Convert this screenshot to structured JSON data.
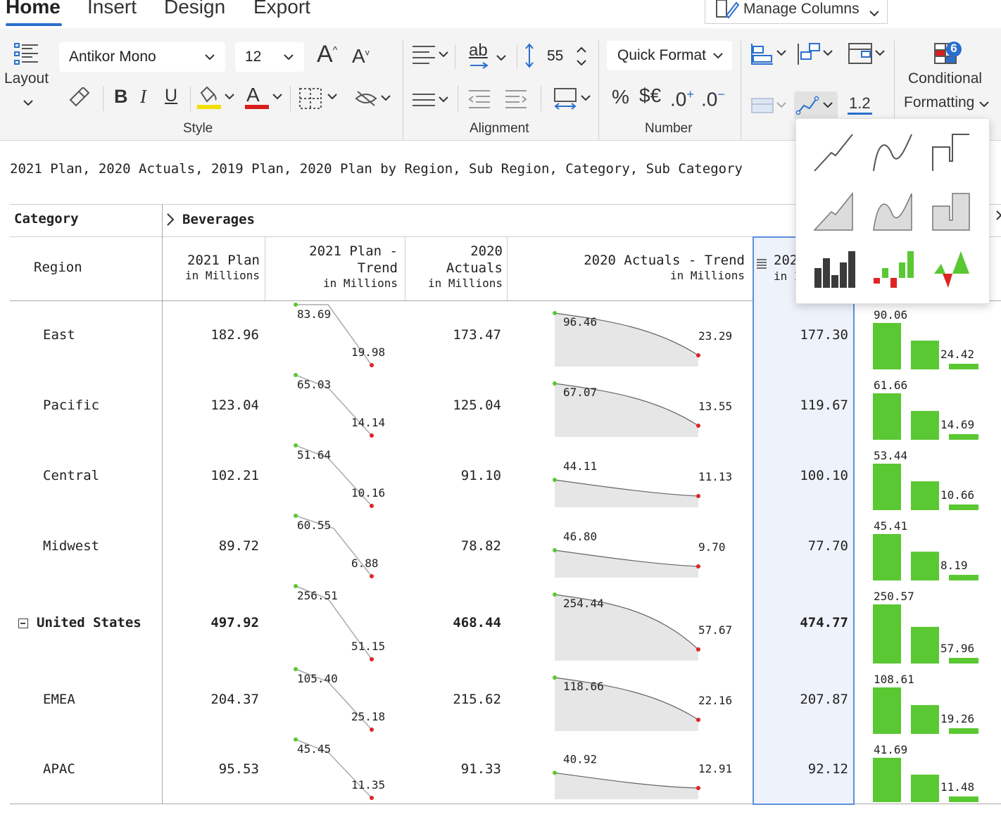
{
  "tabs": [
    {
      "label": "Home",
      "active": true
    },
    {
      "label": "Insert"
    },
    {
      "label": "Design"
    },
    {
      "label": "Export"
    }
  ],
  "manage_columns": "Manage Columns",
  "ribbon": {
    "layout_label": "Layout",
    "font_family": "Antikor Mono",
    "font_size": "12",
    "row_height": "55",
    "quick_format": "Quick Format",
    "percent": "%",
    "currency": "$€",
    "decimal_display": "1.2",
    "conditional_formatting_line1": "Conditional",
    "conditional_formatting_line2": "Formatting",
    "cf_badge": "6",
    "groups": {
      "style": "Style",
      "alignment": "Alignment",
      "number": "Number"
    },
    "style_buttons": {
      "bold": "B",
      "italic": "I",
      "underline": "U",
      "font_color": "A"
    },
    "wrap_text": "ab",
    "grow_font": "A",
    "shrink_font": "A",
    "decimal_inc": ".0",
    "decimal_dec": ".0",
    "colors": {
      "highlight": "#f3e000",
      "font_color": "#d81e1e",
      "accent": "#2a6fcf"
    }
  },
  "caption": "2021 Plan, 2020 Actuals, 2019 Plan, 2020 Plan by Region, Sub Region, Category, Sub Category",
  "table": {
    "category_label": "Category",
    "category_value": "Beverages",
    "region_label": "Region",
    "columns": [
      {
        "title": "2021 Plan",
        "unit": "in Millions"
      },
      {
        "title1": "2021 Plan -",
        "title2": "Trend",
        "unit": "in Millions"
      },
      {
        "title1": "2020",
        "title2": "Actuals",
        "unit": "in Millions"
      },
      {
        "title": "2020 Actuals - Trend",
        "unit": "in Millions"
      },
      {
        "title": "202",
        "unit": "in I"
      }
    ],
    "rows": [
      {
        "region": "East",
        "plan2021": "182.96",
        "trend_start": "83.69",
        "trend_end": "19.98",
        "actuals2020": "173.47",
        "act_start": "96.46",
        "act_end": "23.29",
        "col5": "177.30",
        "bar_top": "90.06",
        "bar_end": "24.42"
      },
      {
        "region": "Pacific",
        "plan2021": "123.04",
        "trend_start": "65.03",
        "trend_end": "14.14",
        "actuals2020": "125.04",
        "act_start": "67.07",
        "act_end": "13.55",
        "col5": "119.67",
        "bar_top": "61.66",
        "bar_end": "14.69"
      },
      {
        "region": "Central",
        "plan2021": "102.21",
        "trend_start": "51.64",
        "trend_end": "10.16",
        "actuals2020": "91.10",
        "act_start": "44.11",
        "act_end": "11.13",
        "col5": "100.10",
        "bar_top": "53.44",
        "bar_end": "10.66"
      },
      {
        "region": "Midwest",
        "plan2021": "89.72",
        "trend_start": "60.55",
        "trend_end": "6.88",
        "actuals2020": "78.82",
        "act_start": "46.80",
        "act_end": "9.70",
        "col5": "77.70",
        "bar_top": "45.41",
        "bar_end": "8.19"
      },
      {
        "region": "United States",
        "bold": true,
        "collapse": true,
        "plan2021": "497.92",
        "trend_start": "256.51",
        "trend_end": "51.15",
        "actuals2020": "468.44",
        "act_start": "254.44",
        "act_end": "57.67",
        "col5": "474.77",
        "bar_top": "250.57",
        "bar_end": "57.96"
      },
      {
        "region": "EMEA",
        "plan2021": "204.37",
        "trend_start": "105.40",
        "trend_end": "25.18",
        "actuals2020": "215.62",
        "act_start": "118.66",
        "act_end": "22.16",
        "col5": "207.87",
        "bar_top": "108.61",
        "bar_end": "19.26"
      },
      {
        "region": "APAC",
        "plan2021": "95.53",
        "trend_start": "45.45",
        "trend_end": "11.35",
        "actuals2020": "91.33",
        "act_start": "40.92",
        "act_end": "12.91",
        "col5": "92.12",
        "bar_top": "41.69",
        "bar_end": "11.48"
      }
    ]
  },
  "chart_popup": {
    "options": [
      "line",
      "smooth-line",
      "step-line",
      "area",
      "smooth-area",
      "step-area",
      "column",
      "variance-column",
      "win-loss"
    ],
    "colors": {
      "positive": "#5ac832",
      "negative": "#e02424",
      "neutral": "#3a3a3a",
      "area": "#dcdcdc"
    }
  }
}
